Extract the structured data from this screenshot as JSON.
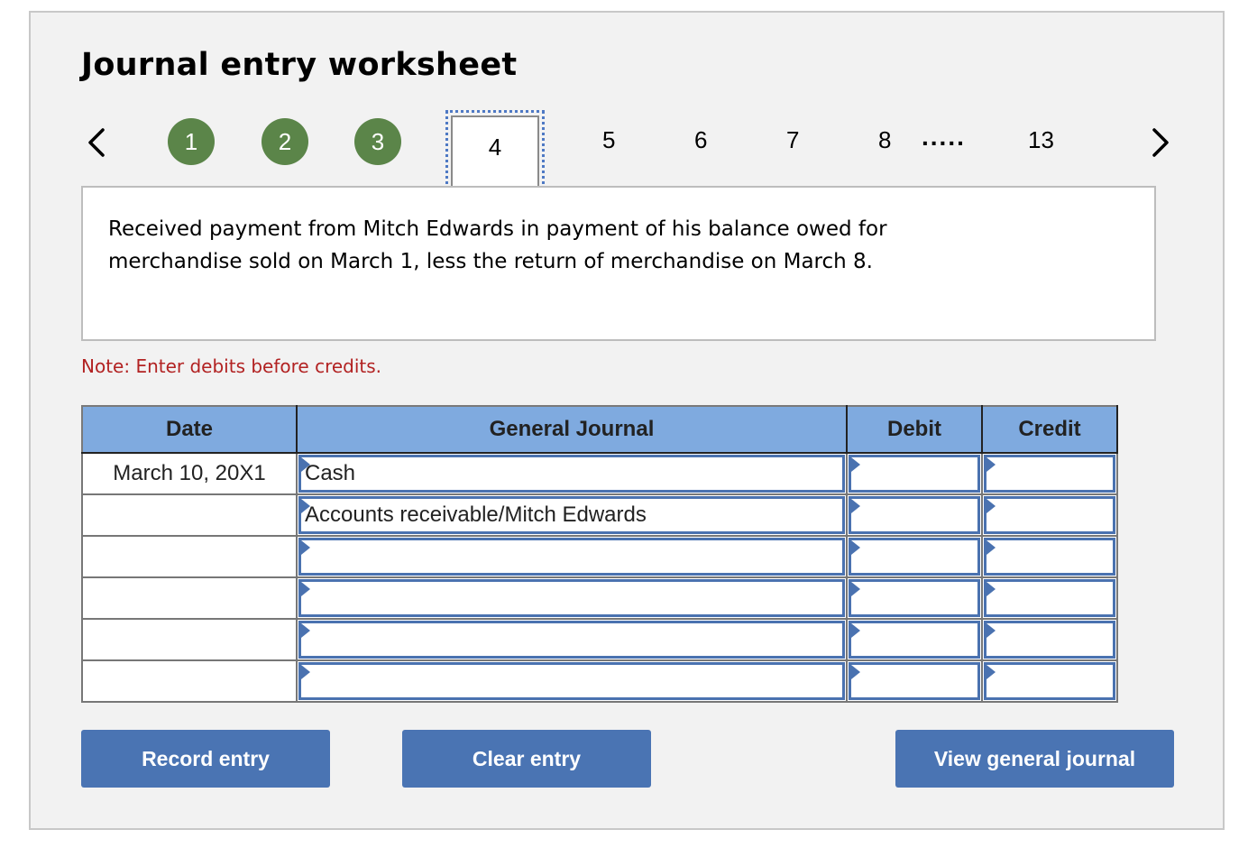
{
  "title": "Journal entry worksheet",
  "navigation": {
    "prev_icon": "chevron-left-icon",
    "next_icon": "chevron-right-icon",
    "completed_steps": [
      "1",
      "2",
      "3"
    ],
    "current_step": "4",
    "upcoming_steps": [
      "5",
      "6",
      "7",
      "8"
    ],
    "ellipsis": ".....",
    "last_step": "13",
    "completed_color": "#5b8549"
  },
  "description": "Received payment from Mitch Edwards in payment of his balance owed for merchandise sold on March 1, less the return of merchandise on March 8.",
  "note": "Note: Enter debits before credits.",
  "table": {
    "headers": [
      "Date",
      "General Journal",
      "Debit",
      "Credit"
    ],
    "header_color": "#7faadf",
    "rows": [
      {
        "date": "March 10, 20X1",
        "account": "Cash",
        "debit": "",
        "credit": ""
      },
      {
        "date": "",
        "account": "Accounts receivable/Mitch Edwards",
        "debit": "",
        "credit": ""
      },
      {
        "date": "",
        "account": "",
        "debit": "",
        "credit": ""
      },
      {
        "date": "",
        "account": "",
        "debit": "",
        "credit": ""
      },
      {
        "date": "",
        "account": "",
        "debit": "",
        "credit": ""
      },
      {
        "date": "",
        "account": "",
        "debit": "",
        "credit": ""
      }
    ]
  },
  "buttons": {
    "record": "Record entry",
    "clear": "Clear entry",
    "view": "View general journal",
    "color": "#4a74b3"
  }
}
